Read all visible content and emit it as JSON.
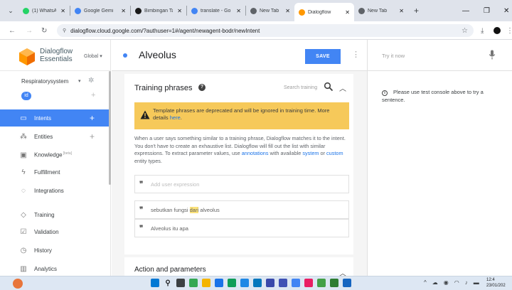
{
  "browser": {
    "tabs": [
      {
        "title": "(1) WhatsApp",
        "color": "#25d366",
        "active": false
      },
      {
        "title": "Google Gemi",
        "color": "#4285f4",
        "active": false
      },
      {
        "title": "Bimbingan Ta",
        "color": "#1a1a1a",
        "active": false
      },
      {
        "title": "translate - Go",
        "color": "#4285f4",
        "active": false
      },
      {
        "title": "New Tab",
        "color": "#5f6368",
        "active": false
      },
      {
        "title": "Dialogflow",
        "color": "#ff9800",
        "active": true
      },
      {
        "title": "New Tab",
        "color": "#5f6368",
        "active": false
      }
    ],
    "url": "dialogflow.cloud.google.com/?authuser=1#/agent/newagent-bodr/newIntent"
  },
  "sidebar": {
    "product_line1": "Dialogflow",
    "product_line2": "Essentials",
    "region": "Global",
    "agent_name": "Respiratorysystem",
    "language": "id",
    "items": [
      {
        "label": "Intents",
        "icon": "chat-bubble-icon",
        "glyph": "▭",
        "plus": true,
        "active": true
      },
      {
        "label": "Entities",
        "icon": "entities-icon",
        "glyph": "⁂",
        "plus": true,
        "active": false
      },
      {
        "label": "Knowledge",
        "beta": "[beta]",
        "icon": "knowledge-icon",
        "glyph": "▣",
        "plus": false,
        "active": false
      },
      {
        "label": "Fulfillment",
        "icon": "bolt-icon",
        "glyph": "ϟ",
        "plus": false,
        "active": false
      },
      {
        "label": "Integrations",
        "icon": "integrations-icon",
        "glyph": "◌",
        "plus": false,
        "active": false
      },
      {
        "label": "Training",
        "icon": "training-icon",
        "glyph": "◇",
        "plus": false,
        "active": false
      },
      {
        "label": "Validation",
        "icon": "validation-icon",
        "glyph": "☑",
        "plus": false,
        "active": false
      },
      {
        "label": "History",
        "icon": "history-icon",
        "glyph": "◷",
        "plus": false,
        "active": false
      },
      {
        "label": "Analytics",
        "icon": "analytics-icon",
        "glyph": "▥",
        "plus": false,
        "active": false
      }
    ]
  },
  "editor": {
    "intent_name": "Alveolus",
    "save_label": "SAVE",
    "training": {
      "title": "Training phrases",
      "search_placeholder": "Search training",
      "warning_text": "Template phrases are deprecated and will be ignored in training time. More details ",
      "warning_link": "here",
      "warning_end": ".",
      "desc_1": "When a user says something similar to a training phrase, Dialogflow matches it to the intent. You don't have to create an exhaustive list. Dialogflow will fill out the list with similar expressions. To extract parameter values, use ",
      "desc_link1": "annotations",
      "desc_2": " with available ",
      "desc_link2": "system",
      "desc_3": " or ",
      "desc_link3": "custom",
      "desc_4": " entity types.",
      "add_placeholder": "Add user expression",
      "phrases": [
        {
          "before": "sebutkan fungsi ",
          "highlight": "dari",
          "after": " alveolus"
        },
        {
          "before": "Alveolus itu apa",
          "highlight": "",
          "after": ""
        }
      ]
    },
    "actions_title": "Action and parameters"
  },
  "console": {
    "placeholder": "Try it now",
    "message": "Please use test console above to try a sentence."
  },
  "taskbar": {
    "time": "12:4",
    "date": "23/01/202"
  }
}
